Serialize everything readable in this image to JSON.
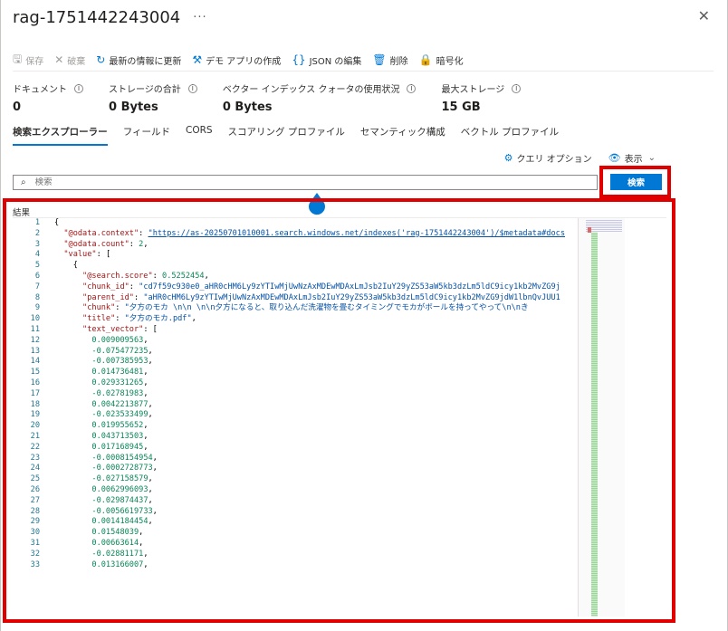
{
  "header": {
    "title": "rag-1751442243004",
    "more": "···",
    "close": "✕"
  },
  "toolbar": {
    "save": "保存",
    "discard": "破棄",
    "refresh": "最新の情報に更新",
    "demo_app": "デモ アプリの作成",
    "edit_json": "JSON の編集",
    "delete": "削除",
    "encrypt": "暗号化"
  },
  "stats": [
    {
      "label": "ドキュメント",
      "value": "0"
    },
    {
      "label": "ストレージの合計",
      "value": "0 Bytes"
    },
    {
      "label": "ベクター インデックス クォータの使用状況",
      "value": "0 Bytes"
    },
    {
      "label": "最大ストレージ",
      "value": "15 GB"
    }
  ],
  "tabs": [
    "検索エクスプローラー",
    "フィールド",
    "CORS",
    "スコアリング プロファイル",
    "セマンティック構成",
    "ベクトル プロファイル"
  ],
  "active_tab": 0,
  "options": {
    "query_options": "クエリ オプション",
    "view": "表示"
  },
  "search": {
    "placeholder": "検索",
    "button": "検索"
  },
  "results": {
    "label": "結果",
    "lines": [
      "{",
      "  \"@odata.context\": \"https://as-20250701010001.search.windows.net/indexes('rag-1751442243004')/$metadata#docs",
      "  \"@odata.count\": 2,",
      "  \"value\": [",
      "    {",
      "      \"@search.score\": 0.5252454,",
      "      \"chunk_id\": \"cd7f59c930e0_aHR0cHM6Ly9zYTIwMjUwNzAxMDEwMDAxLmJsb2IuY29yZS53aW5kb3dzLm5ldC9icy1kb2MvZG9j",
      "      \"parent_id\": \"aHR0cHM6Ly9zYTIwMjUwNzAxMDEwMDAxLmJsb2IuY29yZS53aW5kb3dzLm5ldC9icy1kb2MvZG9jdW1lbnQvJUU1",
      "      \"chunk\": \"夕方のモカ \\n\\n \\n\\n夕方になると、取り込んだ洗濯物を畳むタイミングでモカがボールを持ってやって\\n\\nき",
      "      \"title\": \"夕方のモカ.pdf\",",
      "      \"text_vector\": [",
      "        0.009009563,",
      "        -0.075477235,",
      "        -0.007385953,",
      "        0.014736481,",
      "        0.029331265,",
      "        -0.02781983,",
      "        0.0042213877,",
      "        -0.023533499,",
      "        0.019955652,",
      "        0.043713503,",
      "        0.017168945,",
      "        -0.0008154954,",
      "        -0.0002728773,",
      "        -0.027158579,",
      "        0.0062996093,",
      "        -0.029874437,",
      "        -0.0056619733,",
      "        0.0014184454,",
      "        0.01548039,",
      "        0.00663614,",
      "        -0.02881171,",
      "        0.013166007,"
    ]
  },
  "colors": {
    "accent": "#0078d4",
    "highlight_frame": "#e00000",
    "json_key": "#a31515",
    "json_string": "#0451a5",
    "json_number": "#098658"
  }
}
